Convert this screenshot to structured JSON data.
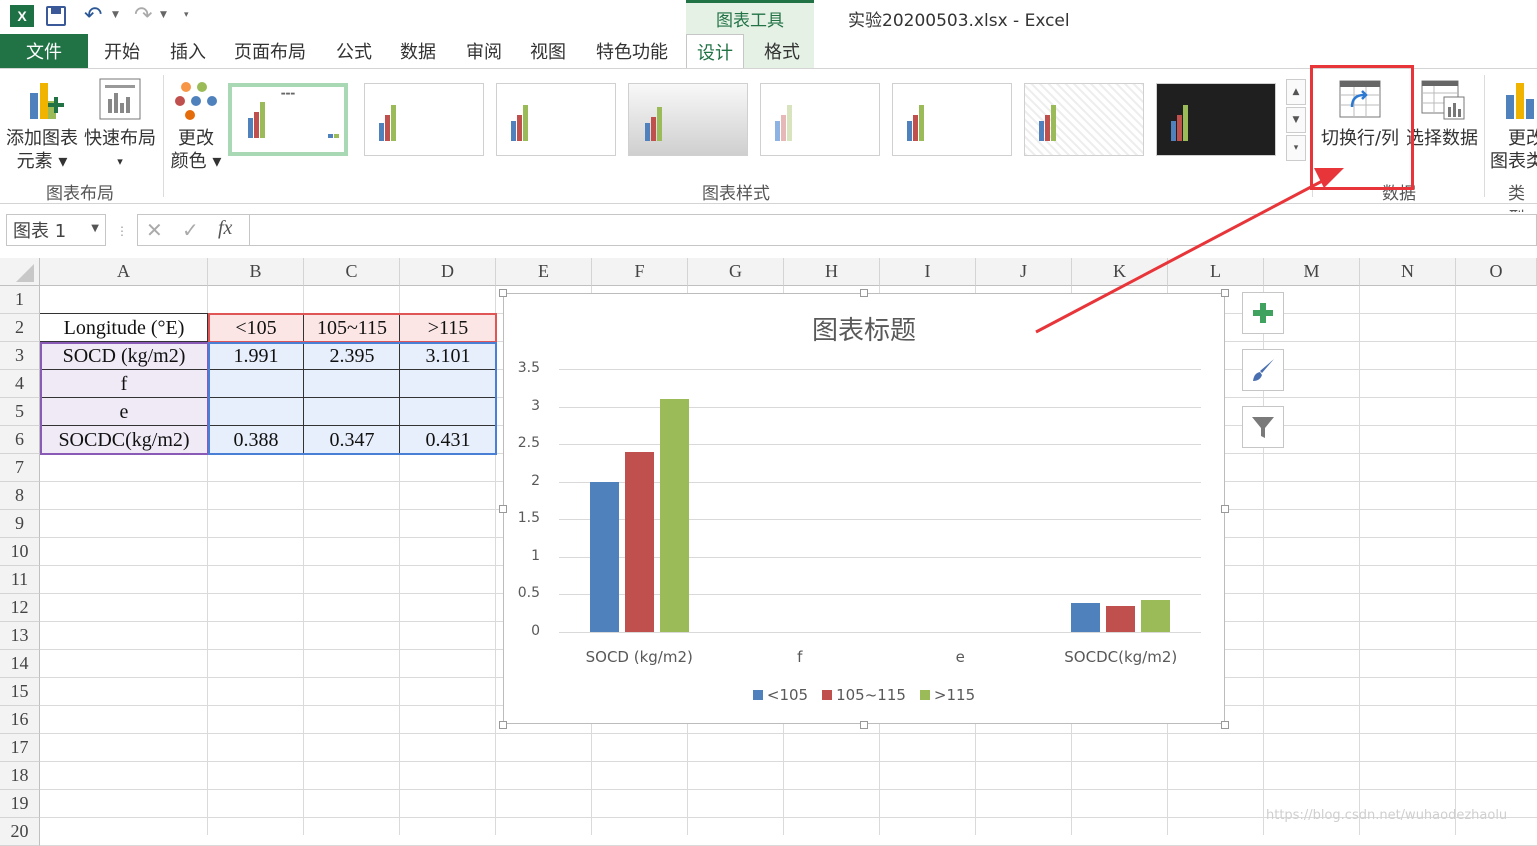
{
  "titlebar": {
    "logo_text": "X",
    "context_tab": "图表工具",
    "doc_title": "实验20200503.xlsx - Excel"
  },
  "tabs": {
    "file": "文件",
    "items": [
      "开始",
      "插入",
      "页面布局",
      "公式",
      "数据",
      "审阅",
      "视图",
      "特色功能",
      "设计",
      "格式"
    ],
    "active": "设计"
  },
  "ribbon": {
    "add_element": [
      "添加图表",
      "元素"
    ],
    "quick_layout": "快速布局",
    "change_color": [
      "更改",
      "颜色"
    ],
    "group_layout": "图表布局",
    "group_styles": "图表样式",
    "switch_row_col": "切换行/列",
    "select_data": "选择数据",
    "group_data": "数据",
    "change_type": [
      "更改",
      "图表类"
    ],
    "group_type": "类型"
  },
  "formula_bar": {
    "name_box": "图表 1",
    "cancel_icon": "✕",
    "confirm_icon": "✓",
    "fx": "fx",
    "formula": ""
  },
  "grid": {
    "columns": [
      "A",
      "B",
      "C",
      "D",
      "E",
      "F",
      "G",
      "H",
      "I",
      "J",
      "K",
      "L",
      "M",
      "N",
      "O"
    ],
    "rows": [
      "1",
      "2",
      "3",
      "4",
      "5",
      "6",
      "7",
      "8",
      "9",
      "10",
      "11",
      "12",
      "13",
      "14",
      "15",
      "16",
      "17",
      "18",
      "19",
      "20"
    ],
    "cells": {
      "A2": "Longitude (°E)",
      "B2": "<105",
      "C2": "105~115",
      "D2": ">115",
      "A3": "SOCD (kg/m2)",
      "B3": "1.991",
      "C3": "2.395",
      "D3": "3.101",
      "A4": "f",
      "A5": "e",
      "A6": "SOCDC(kg/m2)",
      "B6": "0.388",
      "C6": "0.347",
      "D6": "0.431"
    }
  },
  "chart_data": {
    "type": "bar",
    "title": "图表标题",
    "categories": [
      "SOCD (kg/m2)",
      "f",
      "e",
      "SOCDC(kg/m2)"
    ],
    "series": [
      {
        "name": "<105",
        "values": [
          1.991,
          0,
          0,
          0.388
        ],
        "color": "#4f81bd"
      },
      {
        "name": "105~115",
        "values": [
          2.395,
          0,
          0,
          0.347
        ],
        "color": "#c0504d"
      },
      {
        "name": ">115",
        "values": [
          3.101,
          0,
          0,
          0.431
        ],
        "color": "#9bbb59"
      }
    ],
    "yticks": [
      "0",
      "0.5",
      "1",
      "1.5",
      "2",
      "2.5",
      "3",
      "3.5"
    ],
    "ylim": [
      0,
      3.5
    ],
    "grid": true,
    "legend_position": "bottom"
  },
  "colors": {
    "excel_green": "#217346",
    "highlight_red": "#e8353a"
  },
  "watermark": "https://blog.csdn.net/wuhaodezhaolu"
}
